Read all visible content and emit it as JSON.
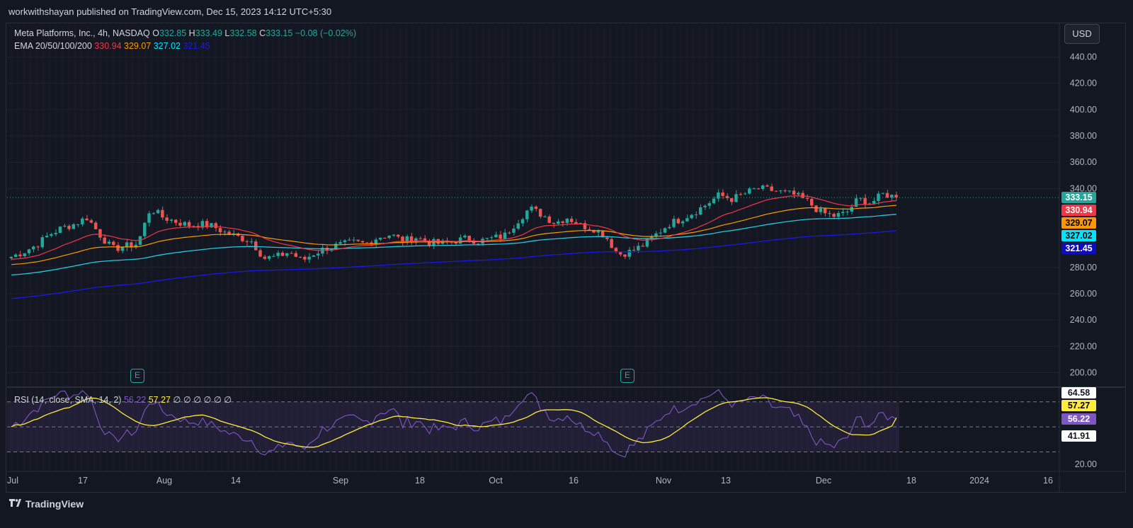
{
  "header": {
    "published": "workwithshayan published on TradingView.com, Dec 15, 2023 14:12 UTC+5:30"
  },
  "legend": {
    "symbol": "Meta Platforms, Inc., 4h, NASDAQ",
    "o_label": "O",
    "o": "332.85",
    "h_label": "H",
    "h": "333.49",
    "l_label": "L",
    "l": "332.58",
    "c_label": "C",
    "c": "333.15",
    "change": "−0.08 (−0.02%)",
    "ema_label": "EMA 20/50/100/200",
    "ema20": "330.94",
    "ema50": "329.07",
    "ema100": "327.02",
    "ema200": "321.45",
    "rsi_label": "RSI (14, close, SMA, 14, 2)",
    "rsi": "56.22",
    "rsi_ma": "57.27",
    "rsi_zeros": "∅ ∅ ∅ ∅ ∅ ∅"
  },
  "currency_button": "USD",
  "earnings_icon_text": "E",
  "price_tags": [
    {
      "value": "333.15",
      "color": "#26a69a",
      "text_color": "#ffffff"
    },
    {
      "value": "330.94",
      "color": "#f23645",
      "text_color": "#ffffff"
    },
    {
      "value": "329.07",
      "color": "#ff9800",
      "text_color": "#000000"
    },
    {
      "value": "327.02",
      "color": "#00e5ff",
      "text_color": "#000000"
    },
    {
      "value": "321.45",
      "color": "#0d0dbf",
      "text_color": "#ffffff"
    }
  ],
  "rsi_tags": [
    {
      "value": "64.58",
      "color": "#ffffff",
      "text_color": "#131722"
    },
    {
      "value": "57.27",
      "color": "#ffeb3b",
      "text_color": "#000000"
    },
    {
      "value": "56.22",
      "color": "#7e57c2",
      "text_color": "#ffffff"
    },
    {
      "value": "41.91",
      "color": "#ffffff",
      "text_color": "#131722"
    }
  ],
  "footer": {
    "brand": "TradingView"
  },
  "colors": {
    "bg": "#131722",
    "grid": "#1e222d",
    "up": "#26a69a",
    "down": "#ef5350",
    "ema20": "#f23645",
    "ema50": "#ff9800",
    "ema100": "#26c6da",
    "ema200": "#1a1ae6",
    "rsi": "#7e57c2",
    "rsi_ma": "#ffeb3b"
  },
  "chart_data": [
    {
      "type": "candlestick",
      "title": "Meta Platforms, Inc., 4h, NASDAQ",
      "y_ticks": [
        "440.00",
        "420.00",
        "400.00",
        "380.00",
        "360.00",
        "340.00",
        "280.00",
        "260.00",
        "240.00",
        "220.00",
        "200.00"
      ],
      "ylim": [
        190,
        450
      ],
      "x_ticks": [
        "Jul",
        "17",
        "Aug",
        "14",
        "Sep",
        "18",
        "Oct",
        "16",
        "Nov",
        "13",
        "Dec",
        "18",
        "2024",
        "16"
      ],
      "close_path": [
        [
          "Jul 4",
          288
        ],
        [
          "Jul 7",
          292
        ],
        [
          "Jul 10",
          297
        ],
        [
          "Jul 13",
          305
        ],
        [
          "Jul 15",
          310
        ],
        [
          "Jul 18",
          313
        ],
        [
          "Jul 20",
          318
        ],
        [
          "Jul 22",
          305
        ],
        [
          "Jul 24",
          294
        ],
        [
          "Jul 26",
          296
        ],
        [
          "Jul 27",
          298
        ],
        [
          "Jul 28",
          325
        ],
        [
          "Jul 31",
          318
        ],
        [
          "Aug 2",
          315
        ],
        [
          "Aug 4",
          312
        ],
        [
          "Aug 7",
          313
        ],
        [
          "Aug 9",
          311
        ],
        [
          "Aug 11",
          306
        ],
        [
          "Aug 14",
          303
        ],
        [
          "Aug 16",
          300
        ],
        [
          "Aug 18",
          287
        ],
        [
          "Aug 21",
          288
        ],
        [
          "Aug 23",
          292
        ],
        [
          "Aug 25",
          285
        ],
        [
          "Aug 28",
          291
        ],
        [
          "Aug 30",
          295
        ],
        [
          "Sep 1",
          297
        ],
        [
          "Sep 5",
          299
        ],
        [
          "Sep 8",
          298
        ],
        [
          "Sep 11",
          303
        ],
        [
          "Sep 13",
          305
        ],
        [
          "Sep 15",
          300
        ],
        [
          "Sep 18",
          303
        ],
        [
          "Sep 20",
          299
        ],
        [
          "Sep 22",
          298
        ],
        [
          "Sep 25",
          300
        ],
        [
          "Sep 27",
          302
        ],
        [
          "Sep 29",
          300
        ],
        [
          "Oct 3",
          302
        ],
        [
          "Oct 5",
          304
        ],
        [
          "Oct 9",
          315
        ],
        [
          "Oct 11",
          325
        ],
        [
          "Oct 13",
          320
        ],
        [
          "Oct 16",
          314
        ],
        [
          "Oct 18",
          318
        ],
        [
          "Oct 20",
          312
        ],
        [
          "Oct 23",
          310
        ],
        [
          "Oct 25",
          304
        ],
        [
          "Oct 26",
          290
        ],
        [
          "Oct 27",
          292
        ],
        [
          "Oct 30",
          297
        ],
        [
          "Nov 1",
          305
        ],
        [
          "Nov 3",
          313
        ],
        [
          "Nov 6",
          317
        ],
        [
          "Nov 8",
          322
        ],
        [
          "Nov 10",
          328
        ],
        [
          "Nov 13",
          335
        ],
        [
          "Nov 15",
          332
        ],
        [
          "Nov 17",
          336
        ],
        [
          "Nov 20",
          340
        ],
        [
          "Nov 22",
          339
        ],
        [
          "Nov 24",
          337
        ],
        [
          "Nov 27",
          335
        ],
        [
          "Nov 29",
          330
        ],
        [
          "Dec 1",
          322
        ],
        [
          "Dec 4",
          319
        ],
        [
          "Dec 6",
          321
        ],
        [
          "Dec 8",
          332
        ],
        [
          "Dec 11",
          329
        ],
        [
          "Dec 13",
          336
        ],
        [
          "Dec 15",
          333.15
        ]
      ],
      "ema": {
        "ema20": 330.94,
        "ema50": 329.07,
        "ema100": 327.02,
        "ema200": 321.45
      },
      "last_close": 333.15
    },
    {
      "type": "line",
      "title": "RSI (14, close, SMA, 14, 2)",
      "y_ticks": [
        "20.00"
      ],
      "ylim": [
        15,
        80
      ],
      "bands": [
        30,
        50,
        70
      ],
      "rsi_last": 56.22,
      "rsi_ma_last": 57.27
    }
  ]
}
